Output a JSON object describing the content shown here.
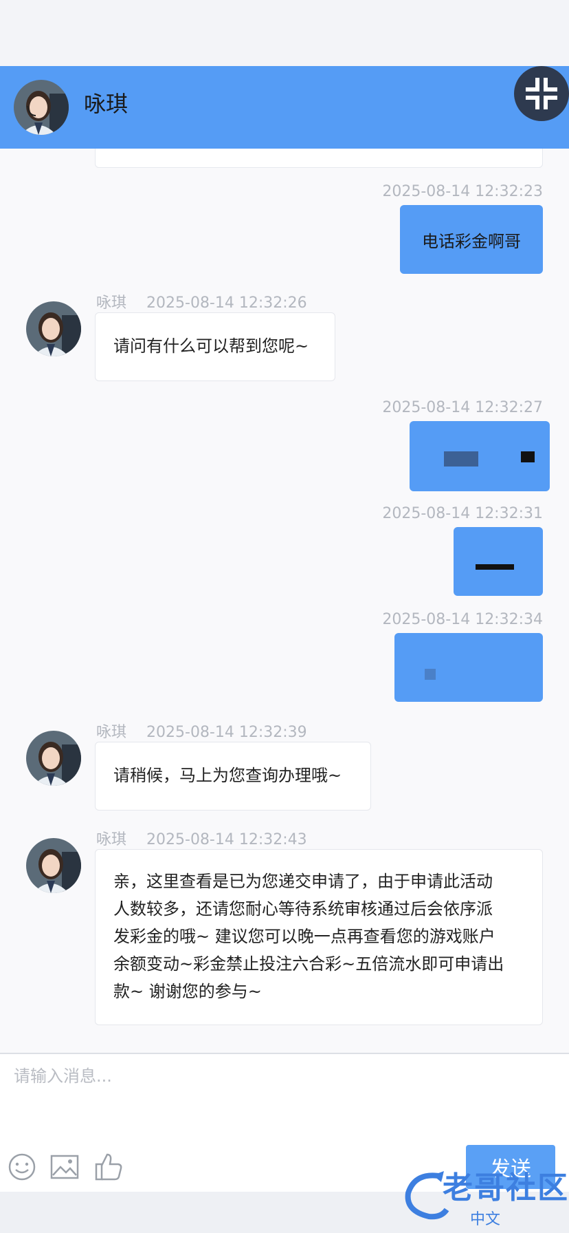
{
  "header": {
    "title": "咏琪"
  },
  "messages": [
    {
      "side": "right",
      "timestamp": "2025-08-14 12:32:23",
      "text": "电话彩金啊哥"
    },
    {
      "side": "left",
      "sender": "咏琪",
      "timestamp": "2025-08-14 12:32:26",
      "text": "请问有什么可以帮到您呢~"
    },
    {
      "side": "right",
      "timestamp": "2025-08-14 12:32:27",
      "text": ""
    },
    {
      "side": "right",
      "timestamp": "2025-08-14 12:32:31",
      "text": ""
    },
    {
      "side": "right",
      "timestamp": "2025-08-14 12:32:34",
      "text": ""
    },
    {
      "side": "left",
      "sender": "咏琪",
      "timestamp": "2025-08-14 12:32:39",
      "text": "请稍候，马上为您查询办理哦~"
    },
    {
      "side": "left",
      "sender": "咏琪",
      "timestamp": "2025-08-14 12:32:43",
      "lines": [
        "亲，这里查看是已为您递交申请了，由于申请此活动",
        "人数较多，还请您耐心等待系统审核通过后会依序派",
        "发彩金的哦~ 建议您可以晚一点再查看您的游戏账户",
        "余额变动~彩金禁止投注六合彩~五倍流水即可申请出",
        "款~ 谢谢您的参与~"
      ]
    }
  ],
  "composer": {
    "placeholder": "请输入消息...",
    "send_label": "发送"
  },
  "icons": [
    "emoji-icon",
    "image-icon",
    "thumbs-up-icon",
    "collapse-icon"
  ],
  "colors": {
    "accent": "#559cf5",
    "background": "#f9f9fb"
  },
  "watermark": {
    "text": "老哥社区",
    "sub": "中文"
  }
}
